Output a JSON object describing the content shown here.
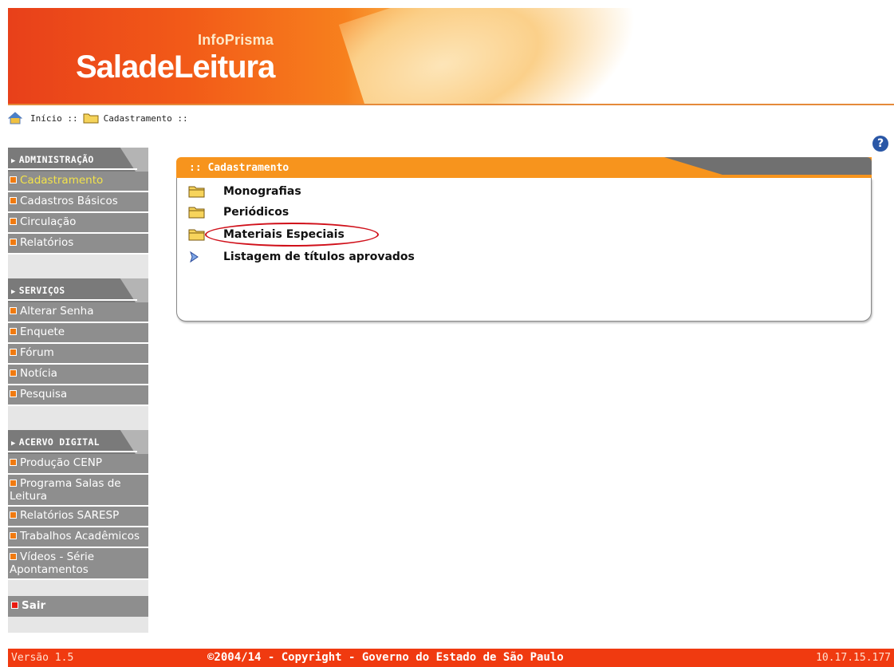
{
  "header": {
    "brand_small": "InfoPrisma",
    "brand_big": "SaladeLeitura"
  },
  "breadcrumb": {
    "home": "Início ::",
    "current": "Cadastramento ::"
  },
  "sidebar": {
    "sections": [
      {
        "title": "ADMINISTRAÇÃO",
        "items": [
          "Cadastramento",
          "Cadastros Básicos",
          "Circulação",
          "Relatórios"
        ]
      },
      {
        "title": "SERVIÇOS",
        "items": [
          "Alterar Senha",
          "Enquete",
          "Fórum",
          "Notícia",
          "Pesquisa"
        ]
      },
      {
        "title": "ACERVO DIGITAL",
        "items": [
          "Produção CENP",
          "Programa Salas de Leitura",
          "Relatórios SARESP",
          "Trabalhos Acadêmicos",
          "Vídeos - Série Apontamentos"
        ]
      }
    ],
    "logout": "Sair"
  },
  "panel": {
    "title": ":: Cadastramento",
    "items": [
      {
        "label": "Monografias",
        "icon": "folder-icon"
      },
      {
        "label": "Periódicos",
        "icon": "folder-icon"
      },
      {
        "label": "Materiais Especiais",
        "icon": "folder-icon"
      },
      {
        "label": "Listagem de títulos aprovados",
        "icon": "arrow-right-icon"
      }
    ]
  },
  "help": "?",
  "footer": {
    "version": "Versão 1.5",
    "copyright": "©2004/14 - Copyright - Governo do Estado de São Paulo",
    "ip": "10.17.15.177"
  },
  "colors": {
    "accent_orange": "#f7941d",
    "footer_red": "#f03a10",
    "sidebar_gray": "#8e8e8e",
    "active_item": "#f3e34a"
  }
}
